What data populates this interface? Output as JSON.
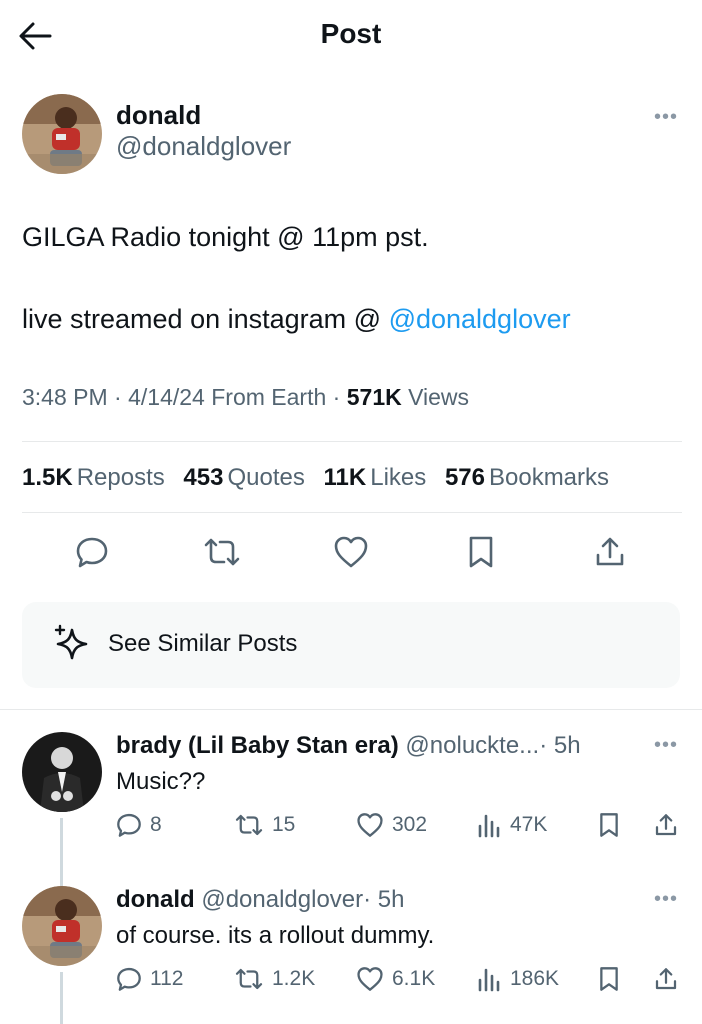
{
  "header": {
    "title": "Post"
  },
  "post": {
    "display_name": "donald",
    "handle": "@donaldglover",
    "text_line1": "GILGA Radio tonight @ 11pm pst.",
    "text_line2_prefix": "live streamed on instagram @ ",
    "text_line2_mention": "@donaldglover",
    "time": "3:48 PM",
    "date": "4/14/24",
    "location": "From Earth",
    "views_count": "571K",
    "views_label": "Views",
    "sep": "·"
  },
  "stats": {
    "reposts_count": "1.5K",
    "reposts_label": "Reposts",
    "quotes_count": "453",
    "quotes_label": "Quotes",
    "likes_count": "11K",
    "likes_label": "Likes",
    "bookmarks_count": "576",
    "bookmarks_label": "Bookmarks"
  },
  "similar": {
    "label": "See Similar Posts"
  },
  "replies": [
    {
      "display_name": "brady (Lil Baby Stan era)",
      "handle": "@noluckte...",
      "time": "· 5h",
      "text": "Music??",
      "replies": "8",
      "reposts": "15",
      "likes": "302",
      "views": "47K"
    },
    {
      "display_name": "donald",
      "handle": "@donaldglover",
      "time": "· 5h",
      "text": "of course. its a rollout dummy.",
      "replies": "112",
      "reposts": "1.2K",
      "likes": "6.1K",
      "views": "186K"
    }
  ],
  "colors": {
    "accent": "#1d9bf0",
    "muted": "#536471",
    "text": "#0f1419"
  }
}
